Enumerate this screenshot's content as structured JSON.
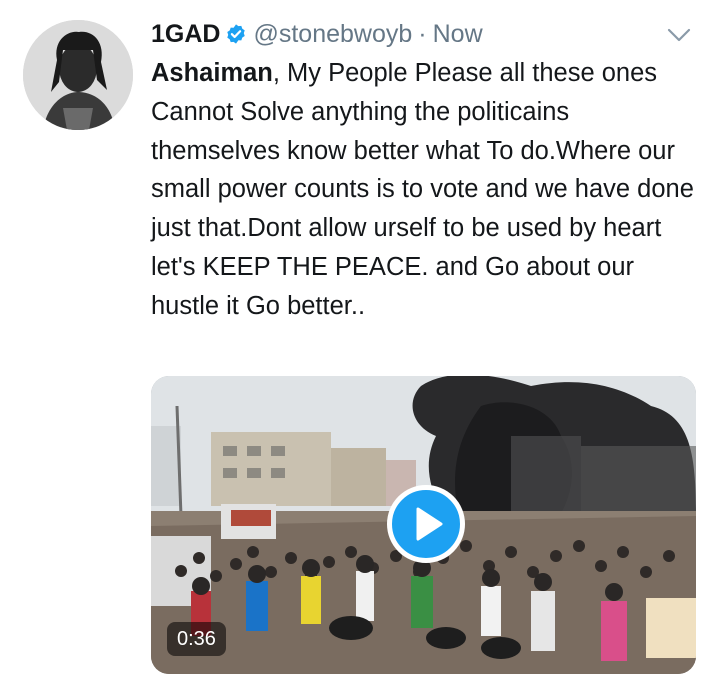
{
  "user": {
    "display_name": "1GAD",
    "handle": "@stonebwoyb",
    "separator": "·",
    "time": "Now",
    "verified": true,
    "avatar_icon": "profile-photo"
  },
  "tweet": {
    "bold_lead": "Ashaiman",
    "body": ", My People Please all these ones Cannot Solve anything the politicains themselves know better what To do.Where our small power counts is to vote and we have done just that.Dont allow urself to be used by heart let's KEEP THE PEACE. and Go about our hustle it Go better.."
  },
  "media": {
    "type": "video",
    "duration": "0:36",
    "play_icon": "play-icon"
  },
  "icons": {
    "more": "chevron-down-icon",
    "verified": "verified-badge-icon"
  },
  "colors": {
    "accent": "#1da1f2",
    "text": "#14171a",
    "secondary": "#657786"
  }
}
